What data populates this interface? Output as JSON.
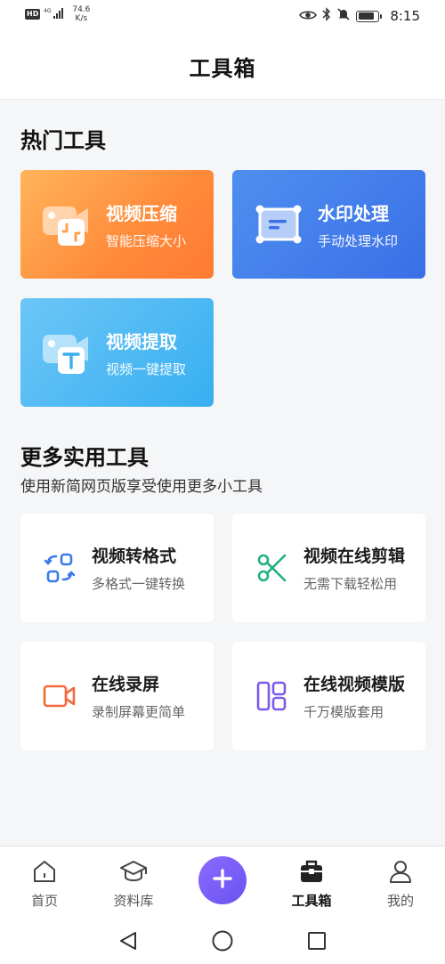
{
  "status_bar": {
    "hd": "HD",
    "network": "4G",
    "speed_value": "74.6",
    "speed_unit": "K/s",
    "time": "8:15",
    "battery_level": 0.85,
    "icons": [
      "eye-icon",
      "bluetooth-icon",
      "bell-muted-icon",
      "battery-icon"
    ]
  },
  "header": {
    "title": "工具箱"
  },
  "hot_tools": {
    "title": "热门工具",
    "items": [
      {
        "name": "视频压缩",
        "desc": "智能压缩大小",
        "icon": "video-compress-icon",
        "color": "#ff8a3a"
      },
      {
        "name": "水印处理",
        "desc": "手动处理水印",
        "icon": "watermark-icon",
        "color": "#3a6fe6"
      },
      {
        "name": "视频提取",
        "desc": "视频一键提取",
        "icon": "video-extract-icon",
        "color": "#37aff0"
      }
    ]
  },
  "more_tools": {
    "title": "更多实用工具",
    "subtitle": "使用新简网页版享受使用更多小工具",
    "items": [
      {
        "name": "视频转格式",
        "desc": "多格式一键转换",
        "icon": "format-convert-icon",
        "color": "#3b7ae8"
      },
      {
        "name": "视频在线剪辑",
        "desc": "无需下载轻松用",
        "icon": "scissors-icon",
        "color": "#23b07d"
      },
      {
        "name": "在线录屏",
        "desc": "录制屏幕更简单",
        "icon": "video-camera-icon",
        "color": "#ef6b3d"
      },
      {
        "name": "在线视频模版",
        "desc": "千万模版套用",
        "icon": "template-layout-icon",
        "color": "#7b5ae6"
      }
    ]
  },
  "tab_bar": {
    "tabs": [
      {
        "label": "首页",
        "icon": "home-icon"
      },
      {
        "label": "资料库",
        "icon": "graduation-cap-icon"
      },
      {
        "label": "工具箱",
        "icon": "toolbox-icon",
        "active": true
      },
      {
        "label": "我的",
        "icon": "user-icon"
      }
    ],
    "add_icon": "plus-icon",
    "accent": "#7a5cf5"
  },
  "nav_bar": {
    "icons": [
      "back-triangle-icon",
      "home-circle-icon",
      "recents-square-icon"
    ]
  }
}
